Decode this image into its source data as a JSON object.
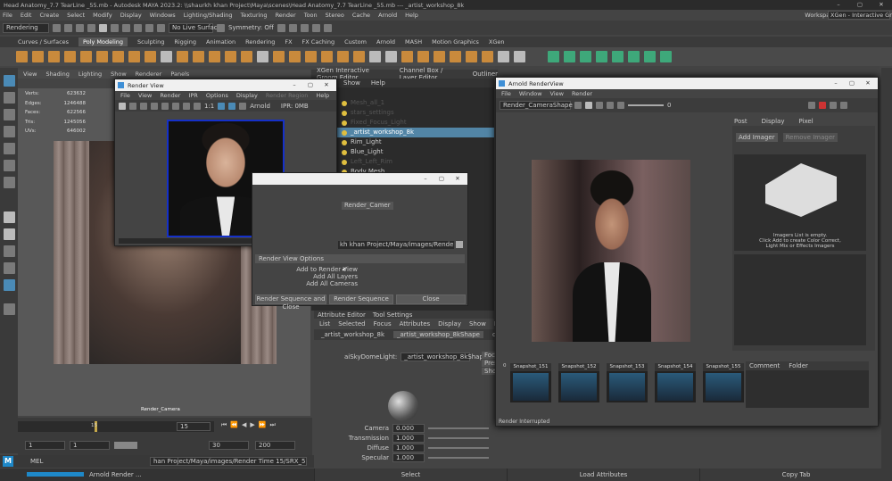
{
  "app": {
    "title": "Head Anatomy_7.7 TearLine _55.mb - Autodesk MAYA 2023.2: \\\\shaurkh khan Project\\Maya\\scenes\\Head Anatomy_7.7 TearLine _55.mb --- _artist_workshop_8k",
    "menu": [
      "File",
      "Edit",
      "Create",
      "Select",
      "Modify",
      "Display",
      "Windows",
      "Lighting/Shading",
      "Texturing",
      "Render",
      "Toon",
      "Stereo",
      "Cache",
      "Arnold",
      "Help"
    ],
    "workspace_label": "Workspace:",
    "workspace_value": "XGen - Interactive Groom*"
  },
  "status": {
    "menuset": "Rendering",
    "live_surface": "No Live Surface",
    "symmetry": "Symmetry: Off"
  },
  "shelf_tabs": [
    "Curves / Surfaces",
    "Poly Modeling",
    "Sculpting",
    "Rigging",
    "Animation",
    "Rendering",
    "FX",
    "FX Caching",
    "Custom",
    "Arnold",
    "MASH",
    "Motion Graphics",
    "XGen"
  ],
  "shelf_active": "Poly Modeling",
  "viewport": {
    "menu": [
      "View",
      "Shading",
      "Lighting",
      "Show",
      "Renderer",
      "Panels"
    ],
    "hud": [
      [
        "Verts:",
        "623632"
      ],
      [
        "Edges:",
        "1246488"
      ],
      [
        "Faces:",
        "622566"
      ],
      [
        "Tris:",
        "1245056"
      ],
      [
        "UVs:",
        "646002"
      ]
    ],
    "camera": "Render_Camera"
  },
  "render_view": {
    "title": "Render View",
    "menu": [
      "File",
      "View",
      "Render",
      "IPR",
      "Options",
      "Display",
      "Render Region",
      "Help"
    ],
    "ratio": "1:1",
    "renderer": "Arnold",
    "ipr": "IPR: 0MB"
  },
  "render_sequence": {
    "camera": "Render_Camer",
    "path": "kh khan Project/Maya/images/Render Time 13",
    "options_header": "Render View Options",
    "options": [
      "Add to Render View",
      "Add All Layers",
      "Add All Cameras"
    ],
    "buttons": [
      "Render Sequence and Close",
      "Render Sequence",
      "Close"
    ]
  },
  "panel_tabs": [
    "XGen Interactive Groom Editor",
    "Channel Box / Layer Editor",
    "Outliner"
  ],
  "outliner": {
    "menu": [
      "Show",
      "Help"
    ],
    "items": [
      {
        "label": "Mesh_all_1",
        "sel": false
      },
      {
        "label": "stars_settings",
        "sel": false
      },
      {
        "label": "Fixed_Focus_Light",
        "sel": false
      },
      {
        "label": "_artist_workshop_8k",
        "sel": true
      },
      {
        "label": "Rim_Light",
        "sel": false
      },
      {
        "label": "Blue_Light",
        "sel": false
      },
      {
        "label": "Left_Left_Rim",
        "sel": false
      },
      {
        "label": "Body Mesh",
        "sel": false
      }
    ]
  },
  "attribute_editor": {
    "tabs_top": [
      "Attribute Editor",
      "Tool Settings"
    ],
    "menu": [
      "List",
      "Selected",
      "Focus",
      "Attributes",
      "Display",
      "Show",
      "Help"
    ],
    "node_tabs": [
      "_artist_workshop_8k",
      "_artist_workshop_8kShape",
      "defaultLightSet"
    ],
    "node_label": "aiSkyDomeLight:",
    "node_value": "_artist_workshop_8kShape",
    "side_buttons": [
      "Focus",
      "Presets",
      "Show"
    ],
    "attrs": [
      [
        "Camera",
        "0.000"
      ],
      [
        "Transmission",
        "1.000"
      ],
      [
        "Diffuse",
        "1.000"
      ],
      [
        "Specular",
        "1.000"
      ]
    ]
  },
  "arnold_view": {
    "title": "Arnold RenderView",
    "menu": [
      "File",
      "Window",
      "View",
      "Render"
    ],
    "camera": "Render_CameraShape",
    "exposure": "0",
    "side_tabs": [
      "Post",
      "Display",
      "Pixel"
    ],
    "add_imager": "Add Imager",
    "remove_imager": "Remove Imager",
    "imagers_empty": "Imagers List is empty.",
    "imagers_hint1": "Click Add to create Color Correct,",
    "imagers_hint2": "Light Mix or Effects Imagers",
    "snapshots": [
      "Snapshot_151",
      "Snapshot_152",
      "Snapshot_153",
      "Snapshot_154",
      "Snapshot_155"
    ],
    "snap_first": "0",
    "comment_tabs": [
      "Comment",
      "Folder"
    ],
    "status": "Render Interrupted"
  },
  "timeline": {
    "current": "15",
    "start": "1",
    "end": "30",
    "range_start": "1",
    "range_end": "200",
    "frame": "15"
  },
  "mel": {
    "label": "MEL",
    "path": "han Project/Maya/images/Render Time 15/SRX_55_1.0015.tif",
    "arnold": "Arnold Render ..."
  },
  "bottom_buttons": [
    "Select",
    "Load Attributes",
    "Copy Tab"
  ]
}
